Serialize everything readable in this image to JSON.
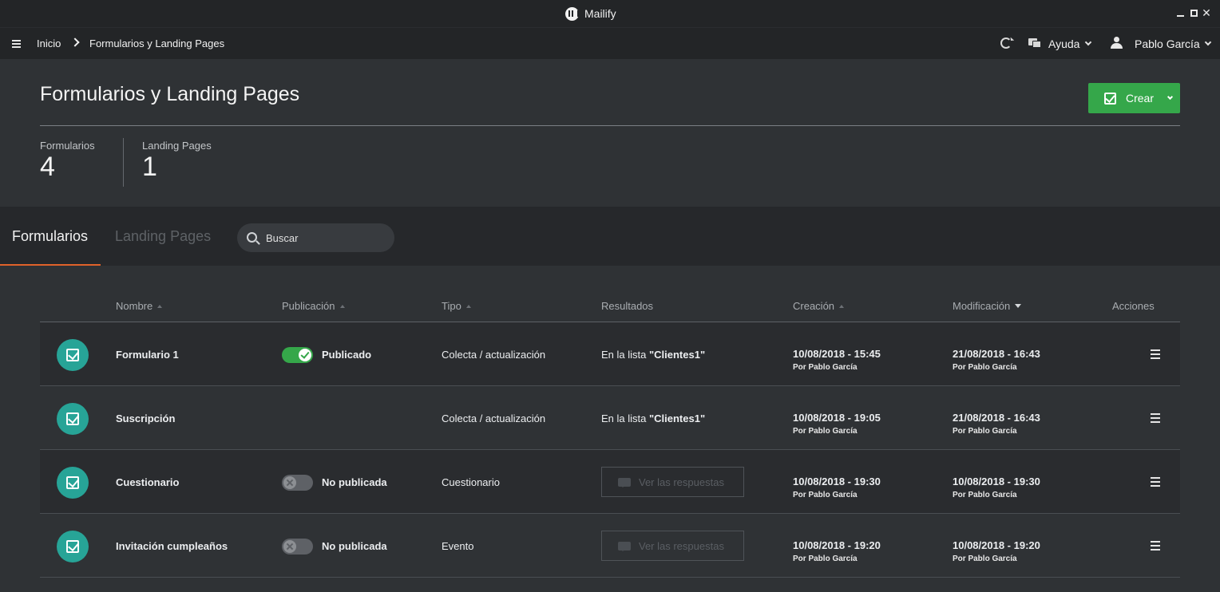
{
  "window": {
    "title": "Mailify"
  },
  "nav": {
    "breadcrumb": [
      "Inicio",
      "Formularios y Landing Pages"
    ],
    "help_label": "Ayuda",
    "user_label": "Pablo García"
  },
  "header": {
    "title": "Formularios y Landing Pages",
    "create_label": "Crear",
    "stats": [
      {
        "label": "Formularios",
        "value": "4"
      },
      {
        "label": "Landing Pages",
        "value": "1"
      }
    ]
  },
  "tabs": {
    "items": [
      {
        "label": "Formularios",
        "active": true
      },
      {
        "label": "Landing Pages",
        "active": false
      }
    ],
    "search_placeholder": "Buscar"
  },
  "table": {
    "columns": [
      "Nombre",
      "Publicación",
      "Tipo",
      "Resultados",
      "Creación",
      "Modificación",
      "Acciones"
    ],
    "rows": [
      {
        "name": "Formulario 1",
        "published": true,
        "publication_label": "Publicado",
        "type": "Colecta / actualización",
        "result_prefix": "En la lista ",
        "result_list": "\"Clientes1\"",
        "created": "10/08/2018 - 15:45",
        "created_by": "Por Pablo García",
        "modified": "21/08/2018 - 16:43",
        "modified_by": "Por Pablo García"
      },
      {
        "name": "Suscripción",
        "published": null,
        "publication_label": "",
        "type": "Colecta / actualización",
        "result_prefix": "En la lista ",
        "result_list": "\"Clientes1\"",
        "created": "10/08/2018 - 19:05",
        "created_by": "Por Pablo García",
        "modified": "21/08/2018 - 16:43",
        "modified_by": "Por Pablo García"
      },
      {
        "name": "Cuestionario",
        "published": false,
        "publication_label": "No publicada",
        "type": "Cuestionario",
        "result_button": "Ver las respuestas",
        "created": "10/08/2018 - 19:30",
        "created_by": "Por Pablo García",
        "modified": "10/08/2018 - 19:30",
        "modified_by": "Por Pablo García"
      },
      {
        "name": "Invitación cumpleaños",
        "published": false,
        "publication_label": "No publicada",
        "type": "Evento",
        "result_button": "Ver las respuestas",
        "created": "10/08/2018 - 19:20",
        "created_by": "Por Pablo García",
        "modified": "10/08/2018 - 19:20",
        "modified_by": "Por Pablo García"
      }
    ]
  },
  "colors": {
    "accent_green": "#35a74a",
    "tab_accent": "#e0622a",
    "form_icon_teal": "#27a497"
  },
  "icons": [
    "app-logo",
    "minimize-icon",
    "maximize-icon",
    "close-icon",
    "hamburger-icon",
    "chevron-right-icon",
    "refresh-icon",
    "chat-icon",
    "user-icon",
    "form-check-icon",
    "search-icon",
    "menu-icon"
  ]
}
